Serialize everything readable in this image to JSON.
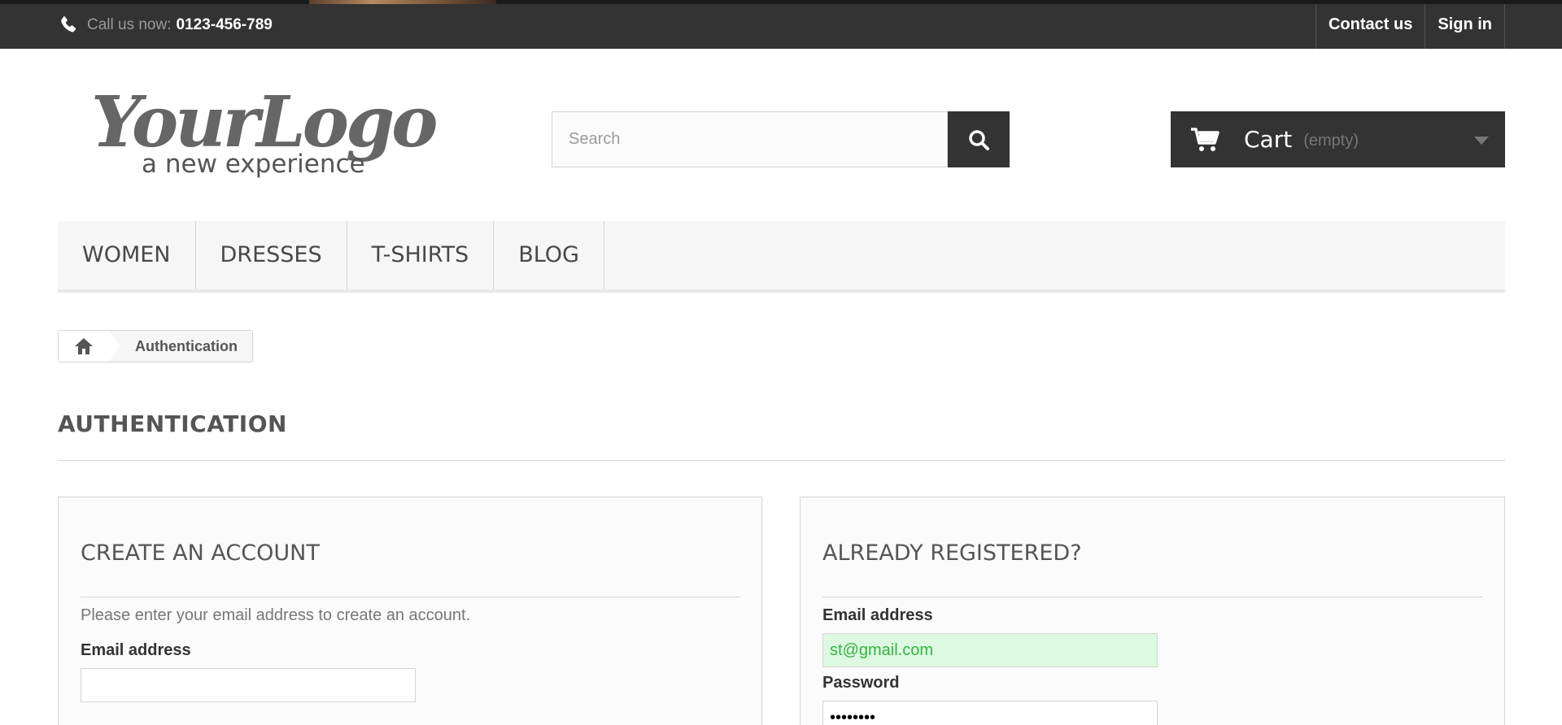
{
  "topbar": {
    "call_label": "Call us now:",
    "phone_number": "0123-456-789",
    "contact_label": "Contact us",
    "signin_label": "Sign in"
  },
  "header": {
    "logo_text": "YourLogo",
    "logo_tagline": "a new experience",
    "search_placeholder": "Search",
    "cart_label": "Cart",
    "cart_status": "(empty)"
  },
  "menu": {
    "items": [
      {
        "label": "WOMEN"
      },
      {
        "label": "DRESSES"
      },
      {
        "label": "T-SHIRTS"
      },
      {
        "label": "BLOG"
      }
    ]
  },
  "breadcrumb": {
    "current": "Authentication"
  },
  "page": {
    "title": "AUTHENTICATION"
  },
  "create_account": {
    "title": "CREATE AN ACCOUNT",
    "intro": "Please enter your email address to create an account.",
    "email_label": "Email address",
    "email_value": ""
  },
  "login": {
    "title": "ALREADY REGISTERED?",
    "email_label": "Email address",
    "email_value": "st@gmail.com",
    "password_label": "Password",
    "password_value": "********"
  },
  "colors": {
    "dark_bar": "#333333",
    "accent_orange": "#f9a51b",
    "valid_green_bg": "#ddf9e1",
    "valid_green_text": "#35b33f"
  },
  "icons": {
    "phone": "phone-icon",
    "search": "search-icon",
    "cart": "cart-icon",
    "home": "home-icon"
  }
}
